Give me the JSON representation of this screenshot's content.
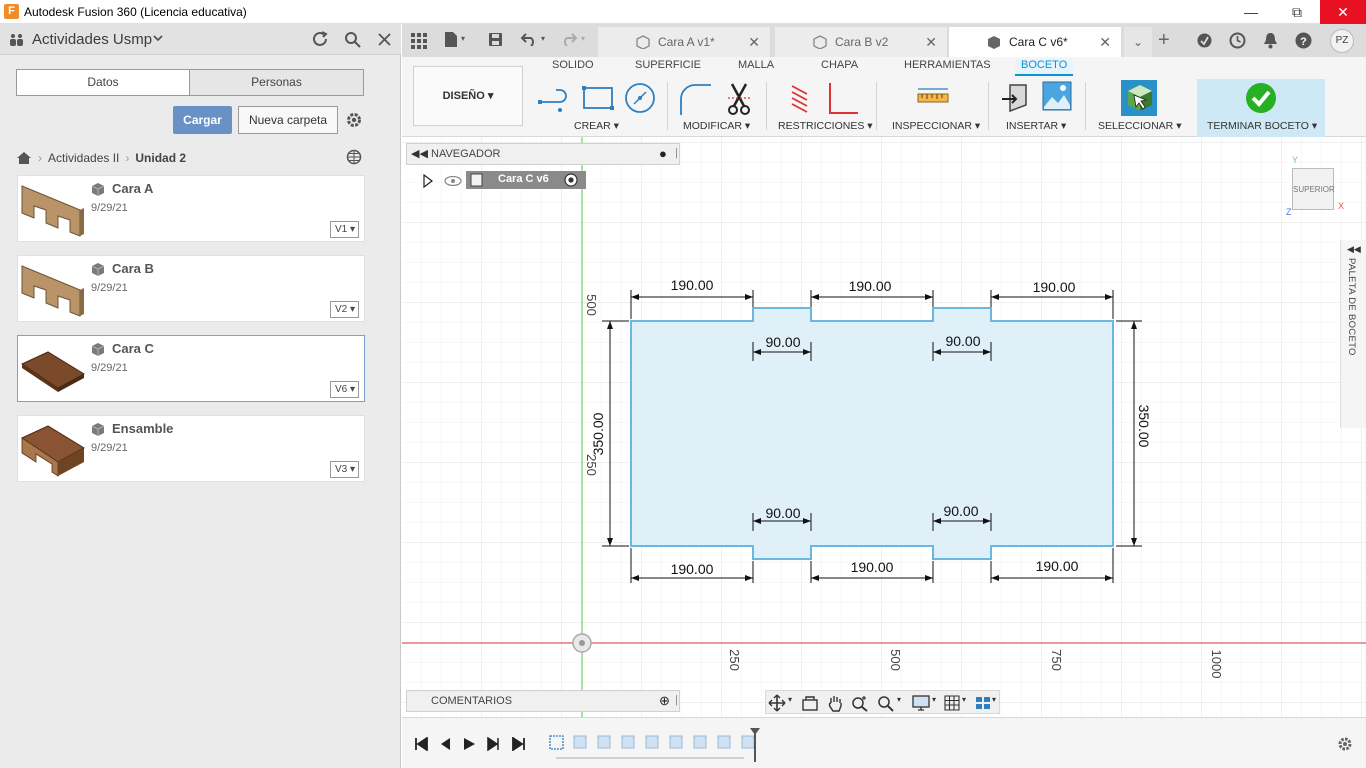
{
  "window": {
    "title": "Autodesk Fusion 360 (Licencia educativa)",
    "logo_letter": "F"
  },
  "left_panel": {
    "project": "Actividades Usmp",
    "segments": [
      "Datos",
      "Personas"
    ],
    "upload_label": "Cargar",
    "new_folder_label": "Nueva carpeta",
    "breadcrumb": [
      "Actividades II",
      "Unidad 2"
    ],
    "files": [
      {
        "name": "Cara A",
        "date": "9/29/21",
        "version": "V1"
      },
      {
        "name": "Cara B",
        "date": "9/29/21",
        "version": "V2"
      },
      {
        "name": "Cara C",
        "date": "9/29/21",
        "version": "V6"
      },
      {
        "name": "Ensamble",
        "date": "9/29/21",
        "version": "V3"
      }
    ]
  },
  "tabs": [
    {
      "label": "Cara A v1*",
      "active": false
    },
    {
      "label": "Cara B v2",
      "active": false
    },
    {
      "label": "Cara C v6*",
      "active": true
    }
  ],
  "user_initials": "PZ",
  "ribbon": {
    "workspace": "DISEÑO",
    "tabs": [
      "SOLIDO",
      "SUPERFICIE",
      "MALLA",
      "CHAPA",
      "HERRAMIENTAS",
      "BOCETO"
    ],
    "active_tab": "BOCETO",
    "groups": [
      "CREAR",
      "MODIFICAR",
      "RESTRICCIONES",
      "INSPECCIONAR",
      "INSERTAR",
      "SELECCIONAR",
      "TERMINAR BOCETO"
    ]
  },
  "browser": {
    "header": "NAVEGADOR",
    "document": "Cara C v6"
  },
  "comments_label": "COMENTARIOS",
  "sketch_palette_label": "PALETA DE BOCETO",
  "viewcube": {
    "face": "SUPERIOR",
    "axes": [
      "Y",
      "X",
      "Z"
    ]
  },
  "axis_ticks": {
    "horizontal": [
      "250",
      "500",
      "750",
      "1000"
    ],
    "vertical": [
      "500",
      "250"
    ]
  },
  "dimensions": {
    "top_widths": [
      "190.00",
      "190.00",
      "190.00"
    ],
    "top_tabs": [
      "90.00",
      "90.00"
    ],
    "bottom_tabs": [
      "90.00",
      "90.00"
    ],
    "bottom_widths": [
      "190.00",
      "190.00",
      "190.00"
    ],
    "height_left": "350.00",
    "height_right": "350.00"
  },
  "colors": {
    "accent": "#0696d7",
    "sketch_fill": "#dff0f9",
    "sketch_line": "#6ab8e0",
    "x_axis": "#e05a5a",
    "y_axis": "#6ad26a",
    "upload_button": "#6991c6"
  }
}
